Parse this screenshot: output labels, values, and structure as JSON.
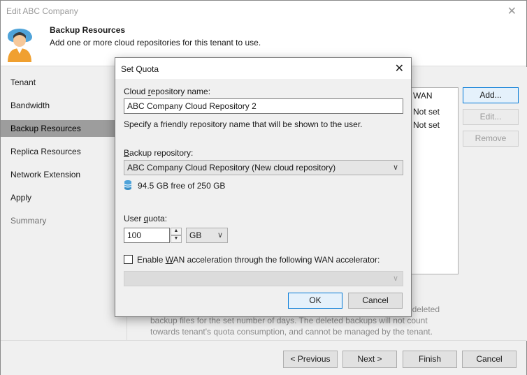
{
  "window": {
    "title": "Edit ABC Company",
    "close_glyph": "✕"
  },
  "header": {
    "title": "Backup Resources",
    "subtitle": "Add one or more cloud repositories for this tenant to use.",
    "icon": "user-cloud-avatar-icon"
  },
  "sidebar": {
    "items": [
      {
        "label": "Tenant",
        "state": "normal"
      },
      {
        "label": "Bandwidth",
        "state": "normal"
      },
      {
        "label": "Backup Resources",
        "state": "active"
      },
      {
        "label": "Replica Resources",
        "state": "normal"
      },
      {
        "label": "Network Extension",
        "state": "normal"
      },
      {
        "label": "Apply",
        "state": "normal"
      },
      {
        "label": "Summary",
        "state": "disabled"
      }
    ]
  },
  "repo_list": {
    "header": "WAN",
    "rows": [
      "Not set",
      "Not set"
    ]
  },
  "side_buttons": {
    "add": "Add...",
    "edit": "Edit...",
    "remove": "Remove"
  },
  "note": {
    "line1": "deleted",
    "line2": "backup files for the set number of days. The deleted backups will not count",
    "line3": "towards tenant's quota consumption, and cannot be managed by the tenant."
  },
  "footer": {
    "previous": "< Previous",
    "next": "Next >",
    "finish": "Finish",
    "cancel": "Cancel"
  },
  "dialog": {
    "title": "Set Quota",
    "close_glyph": "✕",
    "repo_name_label_pre": "Cloud ",
    "repo_name_label_u": "r",
    "repo_name_label_post": "epository name:",
    "repo_name_value": "ABC Company Cloud Repository 2",
    "repo_name_hint": "Specify a friendly repository name that will be shown to the user.",
    "backup_repo_label_u": "B",
    "backup_repo_label_post": "ackup repository:",
    "backup_repo_value": "ABC Company Cloud Repository (New cloud repository)",
    "free_space": "94.5 GB free of 250 GB",
    "user_quota_label_pre": "User ",
    "user_quota_label_u": "q",
    "user_quota_label_post": "uota:",
    "user_quota_value": "100",
    "unit_value": "GB",
    "wan_checkbox_pre": "Enable ",
    "wan_checkbox_u": "W",
    "wan_checkbox_post": "AN acceleration through the following WAN accelerator:",
    "wan_checked": false,
    "wan_accelerator_value": "",
    "ok": "OK",
    "cancel": "Cancel"
  }
}
